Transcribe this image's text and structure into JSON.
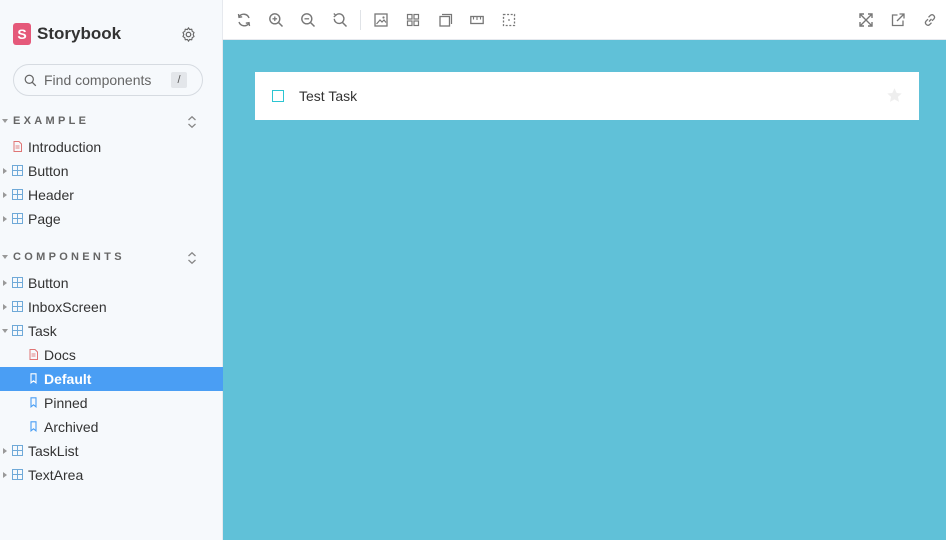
{
  "app": {
    "brand": "Storybook",
    "brand_logo": "S"
  },
  "search": {
    "placeholder": "Find components",
    "shortcut": "/"
  },
  "sections": [
    {
      "title": "EXAMPLE"
    },
    {
      "title": "COMPONENTS"
    }
  ],
  "example_items": [
    {
      "label": "Introduction",
      "type": "docs"
    },
    {
      "label": "Button",
      "type": "component"
    },
    {
      "label": "Header",
      "type": "component"
    },
    {
      "label": "Page",
      "type": "component"
    }
  ],
  "component_items": [
    {
      "label": "Button",
      "type": "component"
    },
    {
      "label": "InboxScreen",
      "type": "component"
    },
    {
      "label": "Task",
      "type": "component",
      "expanded": true
    },
    {
      "label": "Docs",
      "type": "docs"
    },
    {
      "label": "Default",
      "type": "story",
      "selected": true
    },
    {
      "label": "Pinned",
      "type": "story"
    },
    {
      "label": "Archived",
      "type": "story"
    },
    {
      "label": "TaskList",
      "type": "component"
    },
    {
      "label": "TextArea",
      "type": "component"
    }
  ],
  "preview": {
    "task_title": "Test Task"
  },
  "colors": {
    "accent": "#4a9ef4",
    "preview_bg": "#60c1d8",
    "brand": "#e5597a",
    "docs_icon": "#e07575",
    "component_icon": "#6fa9d8"
  }
}
